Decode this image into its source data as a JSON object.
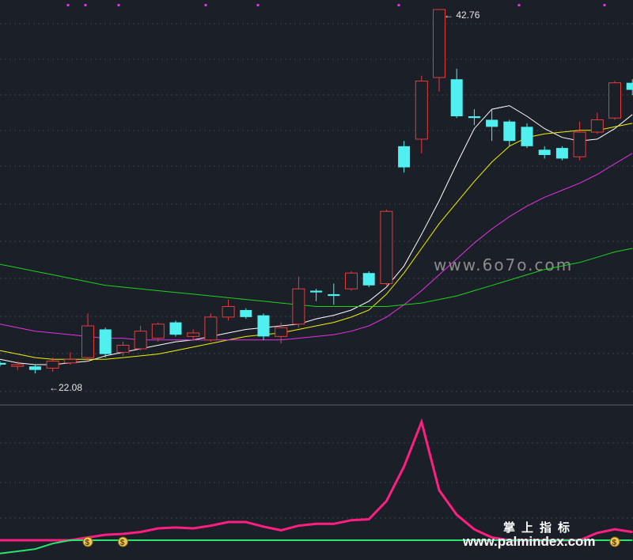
{
  "chart_data": {
    "type": "candlestick",
    "annotations": {
      "high": "42.76",
      "low": "22.08"
    },
    "candles": [
      {
        "o": 22.7,
        "c": 22.6,
        "h": 22.8,
        "l": 22.5
      },
      {
        "o": 22.5,
        "c": 22.6,
        "h": 22.8,
        "l": 22.3
      },
      {
        "o": 22.5,
        "c": 22.3,
        "h": 22.6,
        "l": 22.1
      },
      {
        "o": 22.4,
        "c": 22.8,
        "h": 23.0,
        "l": 22.2
      },
      {
        "o": 22.7,
        "c": 22.9,
        "h": 23.3,
        "l": 22.6
      },
      {
        "o": 23.0,
        "c": 24.8,
        "h": 25.5,
        "l": 22.8
      },
      {
        "o": 24.6,
        "c": 23.2,
        "h": 24.7,
        "l": 23.0
      },
      {
        "o": 23.3,
        "c": 23.7,
        "h": 23.9,
        "l": 23.1
      },
      {
        "o": 23.5,
        "c": 24.5,
        "h": 24.8,
        "l": 23.4
      },
      {
        "o": 24.1,
        "c": 24.9,
        "h": 25.0,
        "l": 23.9
      },
      {
        "o": 25.0,
        "c": 24.3,
        "h": 25.1,
        "l": 24.2
      },
      {
        "o": 24.2,
        "c": 24.4,
        "h": 24.6,
        "l": 24.0
      },
      {
        "o": 24.0,
        "c": 25.3,
        "h": 25.5,
        "l": 23.9
      },
      {
        "o": 25.3,
        "c": 25.9,
        "h": 26.3,
        "l": 25.1
      },
      {
        "o": 25.7,
        "c": 25.3,
        "h": 25.8,
        "l": 25.2
      },
      {
        "o": 25.4,
        "c": 24.2,
        "h": 25.5,
        "l": 24.0
      },
      {
        "o": 24.2,
        "c": 24.7,
        "h": 25.0,
        "l": 23.8
      },
      {
        "o": 24.9,
        "c": 26.9,
        "h": 27.6,
        "l": 24.7
      },
      {
        "o": 26.8,
        "c": 26.7,
        "h": 26.9,
        "l": 26.2
      },
      {
        "o": 26.6,
        "c": 26.5,
        "h": 27.2,
        "l": 26.0
      },
      {
        "o": 26.9,
        "c": 27.8,
        "h": 27.9,
        "l": 26.8
      },
      {
        "o": 27.8,
        "c": 27.1,
        "h": 27.9,
        "l": 27.0
      },
      {
        "o": 27.2,
        "c": 31.3,
        "h": 31.4,
        "l": 27.1
      },
      {
        "o": 35.0,
        "c": 33.8,
        "h": 35.3,
        "l": 33.5
      },
      {
        "o": 35.4,
        "c": 38.7,
        "h": 39.0,
        "l": 34.6
      },
      {
        "o": 38.9,
        "c": 42.76,
        "h": 42.76,
        "l": 38.1
      },
      {
        "o": 38.8,
        "c": 36.7,
        "h": 39.4,
        "l": 36.6
      },
      {
        "o": 36.7,
        "c": 36.6,
        "h": 37.1,
        "l": 36.2
      },
      {
        "o": 36.5,
        "c": 36.1,
        "h": 37.1,
        "l": 35.3
      },
      {
        "o": 36.4,
        "c": 35.3,
        "h": 36.5,
        "l": 35.0
      },
      {
        "o": 36.1,
        "c": 35.0,
        "h": 36.3,
        "l": 34.9
      },
      {
        "o": 34.8,
        "c": 34.5,
        "h": 35.0,
        "l": 34.3
      },
      {
        "o": 34.9,
        "c": 34.3,
        "h": 35.0,
        "l": 34.2
      },
      {
        "o": 34.4,
        "c": 35.8,
        "h": 36.4,
        "l": 34.2
      },
      {
        "o": 35.8,
        "c": 36.5,
        "h": 36.9,
        "l": 35.7
      },
      {
        "o": 36.6,
        "c": 38.6,
        "h": 38.7,
        "l": 36.5
      },
      {
        "o": 38.6,
        "c": 38.2,
        "h": 38.8,
        "l": 37.9
      }
    ],
    "ma_lines": [
      {
        "color": "#ffffff",
        "values": [
          22.9,
          22.7,
          22.6,
          22.6,
          22.7,
          22.8,
          23.1,
          23.3,
          23.5,
          23.7,
          23.9,
          24.0,
          24.2,
          24.4,
          24.6,
          24.7,
          24.8,
          24.9,
          25.2,
          25.4,
          25.7,
          26.2,
          27.0,
          28.2,
          30.0,
          31.9,
          34.0,
          36.0,
          37.1,
          37.3,
          36.7,
          36.0,
          35.5,
          35.3,
          35.4,
          36.0,
          36.8
        ]
      },
      {
        "color": "#f2f200",
        "values": [
          23.4,
          23.2,
          23.0,
          22.9,
          22.9,
          22.9,
          22.9,
          23.0,
          23.1,
          23.2,
          23.4,
          23.6,
          23.8,
          24.0,
          24.2,
          24.3,
          24.4,
          24.6,
          24.8,
          25.0,
          25.3,
          25.7,
          26.6,
          27.8,
          29.2,
          30.6,
          31.8,
          33.0,
          34.1,
          35.0,
          35.5,
          35.7,
          35.8,
          35.9,
          35.9,
          36.1,
          36.3
        ]
      },
      {
        "color": "#e632e6",
        "values": [
          24.9,
          24.7,
          24.5,
          24.4,
          24.3,
          24.2,
          24.1,
          24.1,
          24.0,
          24.0,
          24.0,
          24.0,
          24.0,
          24.0,
          24.0,
          24.0,
          24.0,
          24.1,
          24.2,
          24.3,
          24.5,
          24.8,
          25.3,
          26.0,
          26.8,
          27.7,
          28.6,
          29.5,
          30.3,
          31.0,
          31.6,
          32.1,
          32.5,
          32.9,
          33.4,
          34.0,
          34.6
        ]
      },
      {
        "color": "#1ed21e",
        "values": [
          28.3,
          28.1,
          27.9,
          27.7,
          27.5,
          27.3,
          27.1,
          27.0,
          26.9,
          26.8,
          26.7,
          26.6,
          26.5,
          26.4,
          26.3,
          26.2,
          26.1,
          26.0,
          25.9,
          25.9,
          25.9,
          25.9,
          25.9,
          26.0,
          26.1,
          26.3,
          26.5,
          26.8,
          27.1,
          27.4,
          27.7,
          28.0,
          28.2,
          28.4,
          28.7,
          29.0,
          29.2
        ]
      }
    ],
    "indicator": {
      "line_color": "#ff1e82",
      "base_color": "#28e66e",
      "values": [
        0,
        0,
        0,
        0,
        0,
        3,
        6,
        7,
        9,
        13,
        14,
        13,
        16,
        20,
        20,
        15,
        11,
        16,
        18,
        18,
        22,
        23,
        43,
        81,
        130,
        55,
        28,
        12,
        3,
        0,
        0,
        0,
        0,
        0,
        8,
        12,
        9
      ],
      "base_values": [
        -12,
        -10,
        -8,
        -3,
        0,
        0,
        0,
        0,
        0,
        0,
        0,
        0,
        0,
        0,
        0,
        0,
        0,
        0,
        0,
        0,
        0,
        0,
        0,
        0,
        0,
        0,
        0,
        0,
        0,
        0,
        0,
        0,
        0,
        0,
        0,
        0,
        0
      ],
      "signal_marker_label": "$"
    },
    "watermarks": {
      "site_top": "www.6o7o.com",
      "brand_cn": "掌上指标",
      "site_bottom": "www.palmindex.com"
    }
  }
}
